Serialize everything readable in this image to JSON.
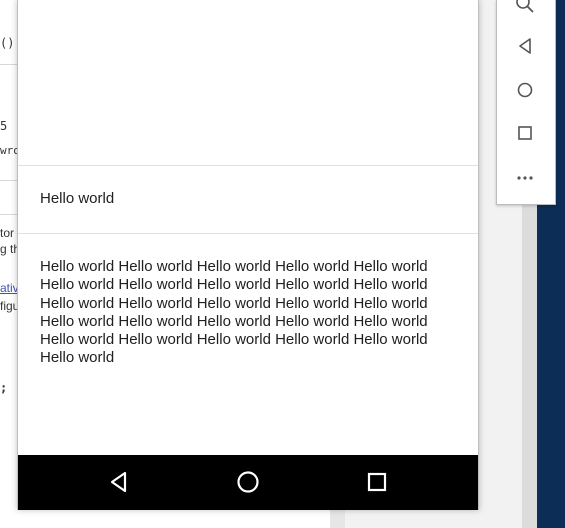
{
  "ide": {
    "fragments": [
      "()",
      "5 ,",
      "wro",
      "tor",
      "g th",
      "ativ",
      "figu",
      ";"
    ]
  },
  "app": {
    "short_text": "Hello world",
    "long_text": "Hello world Hello world Hello world Hello world Hello world Hello world Hello world Hello world Hello world Hello world Hello world Hello world Hello world Hello world Hello world Hello world Hello world Hello world Hello world Hello world Hello world Hello world Hello world Hello world Hello world Hello world"
  },
  "navbar": {
    "buttons": [
      "back-icon",
      "home-icon",
      "overview-icon"
    ],
    "background": "#000000"
  },
  "toolbar": {
    "buttons": [
      "zoom-icon",
      "back-icon",
      "home-icon",
      "overview-icon",
      "more-icon"
    ]
  },
  "colors": {
    "desktop": "#0c2d55",
    "link": "#3f51b5"
  }
}
